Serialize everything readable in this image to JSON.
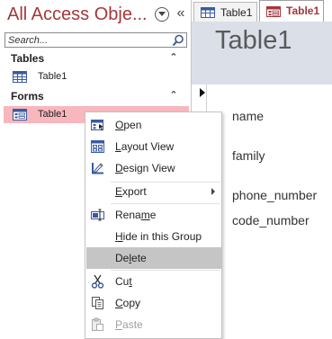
{
  "nav": {
    "title": "All Access Obje...",
    "search": {
      "placeholder": "Search..."
    },
    "groups": [
      {
        "label": "Tables",
        "items": [
          {
            "label": "Table1"
          }
        ]
      },
      {
        "label": "Forms",
        "items": [
          {
            "label": "Table1"
          }
        ]
      }
    ]
  },
  "tabs": [
    {
      "label": "Table1",
      "icon": "table-icon"
    },
    {
      "label": "Table1",
      "icon": "form-icon"
    }
  ],
  "form": {
    "title": "Table1",
    "fields": [
      "name",
      "family",
      "phone_number",
      "code_number"
    ]
  },
  "context_menu": {
    "items": [
      {
        "label": "Open",
        "accel": "O",
        "icon": "open-form-icon"
      },
      {
        "label": "Layout View",
        "accel": "L",
        "icon": "layout-view-icon"
      },
      {
        "label": "Design View",
        "accel": "D",
        "icon": "design-view-icon"
      },
      {
        "label": "Export",
        "accel": "E",
        "icon": "",
        "submenu": true
      },
      {
        "label": "Rename",
        "accel": "m",
        "icon": "rename-icon"
      },
      {
        "label": "Hide in this Group",
        "accel": "H",
        "icon": ""
      },
      {
        "label": "Delete",
        "accel": "l",
        "icon": "",
        "highlighted": true
      },
      {
        "label": "Cut",
        "accel": "t",
        "icon": "scissors-icon"
      },
      {
        "label": "Copy",
        "accel": "C",
        "icon": "copy-icon"
      },
      {
        "label": "Paste",
        "accel": "P",
        "icon": "paste-icon",
        "disabled": true
      }
    ]
  },
  "colors": {
    "accent": "#a4373a",
    "selection": "#f7b7bd",
    "form_header": "#dbdfe8",
    "menu_hover": "#c5c5c5"
  }
}
